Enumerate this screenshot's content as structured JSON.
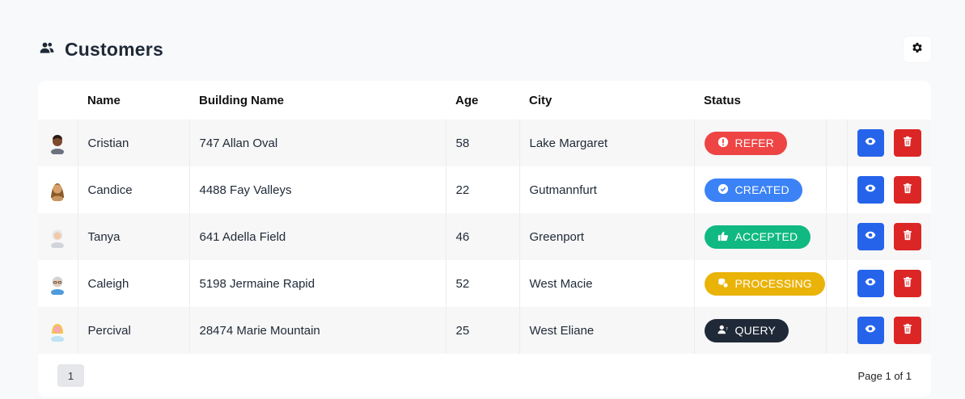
{
  "header": {
    "title": "Customers",
    "icon": "users-icon",
    "settings_icon": "gear-icon"
  },
  "table": {
    "columns": [
      "",
      "Name",
      "Building Name",
      "Age",
      "City",
      "Status",
      "",
      ""
    ],
    "rows": [
      {
        "avatar": "avatar-dark",
        "name": "Cristian",
        "building": "747 Allan Oval",
        "age": "58",
        "city": "Lake Margaret",
        "status": "REFER",
        "status_color": "#ef4444",
        "status_icon": "alert-circle-icon"
      },
      {
        "avatar": "avatar-tan",
        "name": "Candice",
        "building": "4488 Fay Valleys",
        "age": "22",
        "city": "Gutmannfurt",
        "status": "CREATED",
        "status_color": "#3b82f6",
        "status_icon": "check-circle-icon"
      },
      {
        "avatar": "avatar-elder",
        "name": "Tanya",
        "building": "641 Adella Field",
        "age": "46",
        "city": "Greenport",
        "status": "ACCEPTED",
        "status_color": "#10b981",
        "status_icon": "thumbs-up-icon"
      },
      {
        "avatar": "avatar-glasses",
        "name": "Caleigh",
        "building": "5198 Jermaine Rapid",
        "age": "52",
        "city": "West Macie",
        "status": "PROCESSING",
        "status_color": "#eab308",
        "status_icon": "coins-icon"
      },
      {
        "avatar": "avatar-blonde",
        "name": "Percival",
        "building": "28474 Marie Mountain",
        "age": "25",
        "city": "West Eliane",
        "status": "QUERY",
        "status_color": "#1f2937",
        "status_icon": "user-question-icon"
      }
    ]
  },
  "footer": {
    "page": "1",
    "page_info": "Page 1 of 1"
  },
  "colors": {
    "view": "#2563eb",
    "delete": "#dc2626",
    "background": "#f8f9fb"
  }
}
